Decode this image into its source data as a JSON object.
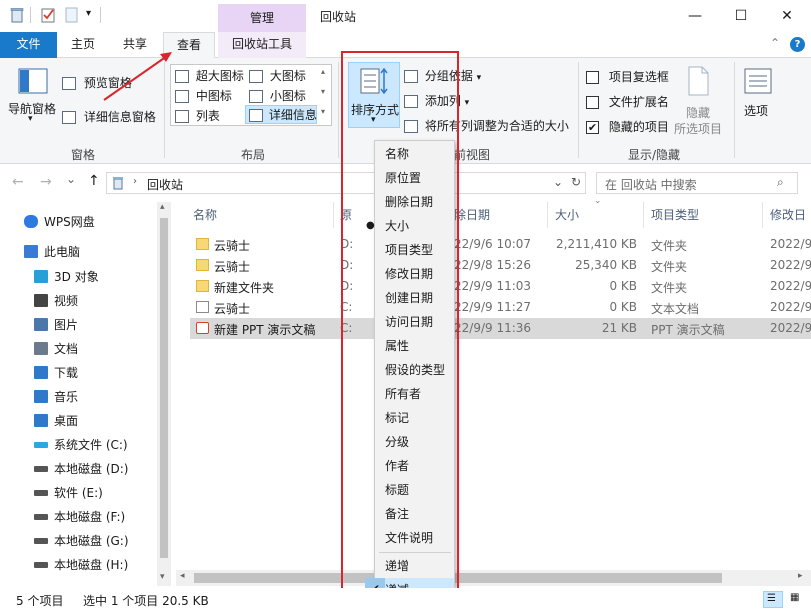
{
  "window": {
    "title": "回收站",
    "context_tab_header": "管理",
    "controls": {
      "minimize": "—",
      "maximize": "☐",
      "close": "✕"
    }
  },
  "tabs": {
    "file": "文件",
    "home": "主页",
    "share": "共享",
    "view": "查看",
    "recycle_tools": "回收站工具"
  },
  "ribbon": {
    "pane_group": {
      "navigation_pane": "导航窗格",
      "preview_pane": "预览窗格",
      "details_pane": "详细信息窗格",
      "name": "窗格"
    },
    "layout_group": {
      "items": [
        "超大图标",
        "大图标",
        "中图标",
        "小图标",
        "列表",
        "详细信息"
      ],
      "selected": "详细信息",
      "name": "布局"
    },
    "current_view": {
      "sort_by": "排序方式",
      "group_by": "分组依据",
      "add_columns": "添加列",
      "fit_columns": "将所有列调整为合适的大小",
      "name": "当前视图",
      "visible_name_fragment": "前视图"
    },
    "show_hide": {
      "item_checkboxes": "项目复选框",
      "file_extensions": "文件扩展名",
      "hidden_items": "隐藏的项目",
      "hidden_items_checked": true,
      "hide_selected": "隐藏",
      "hide_selected_sub": "所选项目",
      "name": "显示/隐藏"
    },
    "options": "选项"
  },
  "nav": {
    "back": "←",
    "forward": "→",
    "recent": "⌄",
    "up": "↑",
    "address": "回收站",
    "search_placeholder": "在 回收站 中搜索"
  },
  "sidebar": {
    "items": [
      {
        "label": "WPS网盘",
        "icon": "cloud-icon"
      },
      {
        "label": "此电脑",
        "icon": "computer-icon"
      },
      {
        "label": "3D 对象",
        "icon": "cube-icon"
      },
      {
        "label": "视频",
        "icon": "video-icon"
      },
      {
        "label": "图片",
        "icon": "picture-icon"
      },
      {
        "label": "文档",
        "icon": "document-icon"
      },
      {
        "label": "下载",
        "icon": "download-icon"
      },
      {
        "label": "音乐",
        "icon": "music-icon"
      },
      {
        "label": "桌面",
        "icon": "desktop-icon"
      },
      {
        "label": "系统文件 (C:)",
        "icon": "system-drive-icon"
      },
      {
        "label": "本地磁盘 (D:)",
        "icon": "drive-icon"
      },
      {
        "label": "软件 (E:)",
        "icon": "drive-icon"
      },
      {
        "label": "本地磁盘 (F:)",
        "icon": "drive-icon"
      },
      {
        "label": "本地磁盘 (G:)",
        "icon": "drive-icon"
      },
      {
        "label": "本地磁盘 (H:)",
        "icon": "drive-icon"
      }
    ]
  },
  "table": {
    "columns": [
      "名称",
      "原",
      "除日期",
      "大小",
      "项目类型",
      "修改日"
    ],
    "rows": [
      {
        "name": "云骑士",
        "orig": "D:",
        "date": "22/9/6 10:07",
        "size": "2,211,410 KB",
        "type": "文件夹",
        "modified": "2022/9",
        "icon": "folder-icon"
      },
      {
        "name": "云骑士",
        "orig": "D:",
        "date": "22/9/8 15:26",
        "size": "25,340 KB",
        "type": "文件夹",
        "modified": "2022/9",
        "icon": "folder-icon"
      },
      {
        "name": "新建文件夹",
        "orig": "D:",
        "date": "22/9/9 11:03",
        "size": "0 KB",
        "type": "文件夹",
        "modified": "2022/9",
        "icon": "folder-icon"
      },
      {
        "name": "云骑士",
        "orig": "C:",
        "date": "22/9/9 11:27",
        "size": "0 KB",
        "type": "文本文档",
        "modified": "2022/9",
        "icon": "text-file-icon"
      },
      {
        "name": "新建 PPT 演示文稿",
        "orig": "C:",
        "date": "22/9/9 11:36",
        "size": "21 KB",
        "type": "PPT 演示文稿",
        "modified": "2022/9",
        "icon": "ppt-file-icon",
        "selected": true
      }
    ]
  },
  "sort_menu": {
    "items": [
      "名称",
      "原位置",
      "删除日期",
      "大小",
      "项目类型",
      "修改日期",
      "创建日期",
      "访问日期",
      "属性",
      "假设的类型",
      "所有者",
      "标记",
      "分级",
      "作者",
      "标题",
      "备注",
      "文件说明"
    ],
    "selected_item": "大小",
    "order": [
      "递增",
      "递减"
    ],
    "selected_order": "递减"
  },
  "status": {
    "count": "5 个项目",
    "selection": "选中 1 个项目  20.5 KB"
  },
  "colors": {
    "file_tab": "#1979ca",
    "context_tab": "#e8d4f4",
    "highlight_red": "#d9262c",
    "selection": "#cce8ff"
  }
}
